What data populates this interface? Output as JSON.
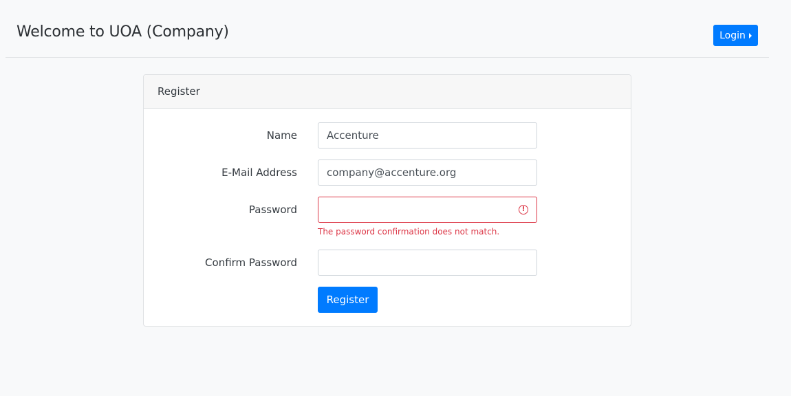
{
  "header": {
    "title": "Welcome to UOA (Company)",
    "login_label": "Login"
  },
  "card": {
    "title": "Register"
  },
  "form": {
    "name": {
      "label": "Name",
      "value": "Accenture"
    },
    "email": {
      "label": "E-Mail Address",
      "value": "company@accenture.org"
    },
    "password": {
      "label": "Password",
      "value": "",
      "error": "The password confirmation does not match."
    },
    "confirm_password": {
      "label": "Confirm Password",
      "value": ""
    },
    "submit_label": "Register"
  },
  "colors": {
    "primary": "#007bff",
    "danger": "#dc3545",
    "background": "#f8f9fa"
  },
  "icons": {
    "login_caret": "caret-right-icon",
    "password_invalid": "exclamation-circle-icon"
  }
}
